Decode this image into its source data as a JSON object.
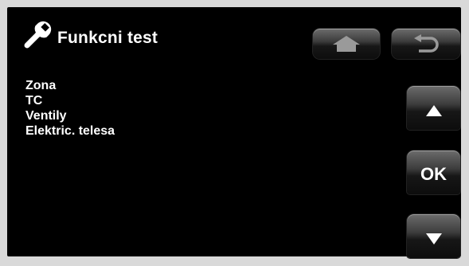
{
  "header": {
    "title": "Funkcni test",
    "title_icon": "wrench-icon"
  },
  "menu": {
    "items": [
      {
        "label": "Zona"
      },
      {
        "label": "TC"
      },
      {
        "label": "Ventily"
      },
      {
        "label": "Elektric. telesa"
      }
    ]
  },
  "buttons": {
    "home_icon": "home-icon",
    "back_icon": "back-arrow-icon",
    "up_icon": "triangle-up-icon",
    "ok_label": "OK",
    "down_icon": "triangle-down-icon"
  },
  "colors": {
    "background": "#000000",
    "text": "#ffffff",
    "bezel": "#d9d9d9"
  }
}
